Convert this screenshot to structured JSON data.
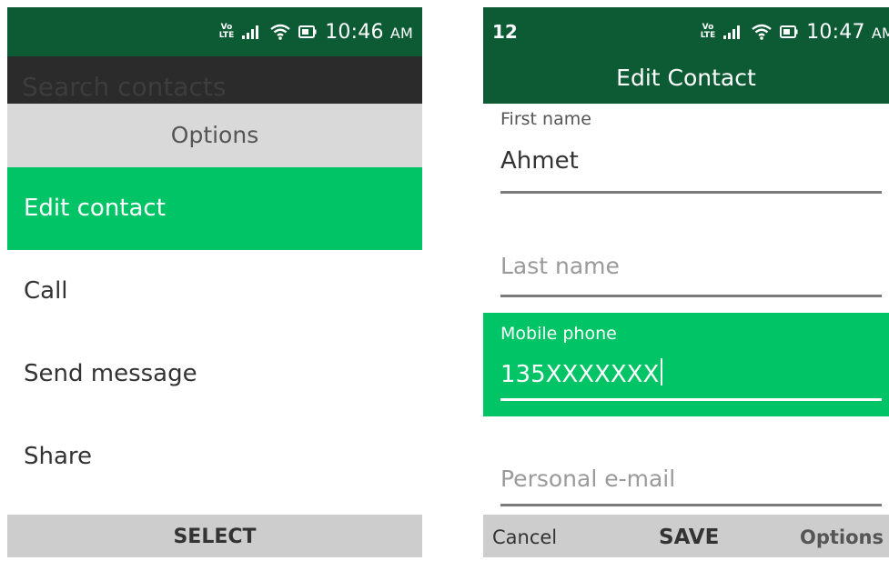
{
  "left_screen": {
    "status_bar": {
      "time": "10:46",
      "ampm": "AM",
      "volte_top": "Vo",
      "volte_bottom": "LTE"
    },
    "search": {
      "placeholder": "Search contacts"
    },
    "options_title": "Options",
    "menu_items": [
      {
        "label": "Edit contact",
        "selected": true
      },
      {
        "label": "Call",
        "selected": false
      },
      {
        "label": "Send message",
        "selected": false
      },
      {
        "label": "Share",
        "selected": false
      }
    ],
    "softkey_center": "SELECT"
  },
  "right_screen": {
    "status_bar": {
      "notification_count": "12",
      "time": "10:47",
      "ampm": "AM",
      "volte_top": "Vo",
      "volte_bottom": "LTE"
    },
    "header_title": "Edit Contact",
    "fields": {
      "first_name": {
        "label": "First name",
        "value": "Ahmet"
      },
      "last_name": {
        "placeholder": "Last name"
      },
      "mobile_phone": {
        "label": "Mobile phone",
        "value": "135XXXXXXX"
      },
      "personal_email": {
        "placeholder": "Personal e-mail"
      }
    },
    "softkeys": {
      "left": "Cancel",
      "center": "SAVE",
      "right": "Options"
    }
  },
  "colors": {
    "header_green": "#0d5b34",
    "highlight_green": "#00c465",
    "softkey_gray": "#cdcdcd",
    "options_header_gray": "#d9d9d9",
    "search_bar_dark": "#2b2b2b"
  },
  "icons": [
    "volte-icon",
    "signal-icon",
    "wifi-icon",
    "battery-icon"
  ]
}
